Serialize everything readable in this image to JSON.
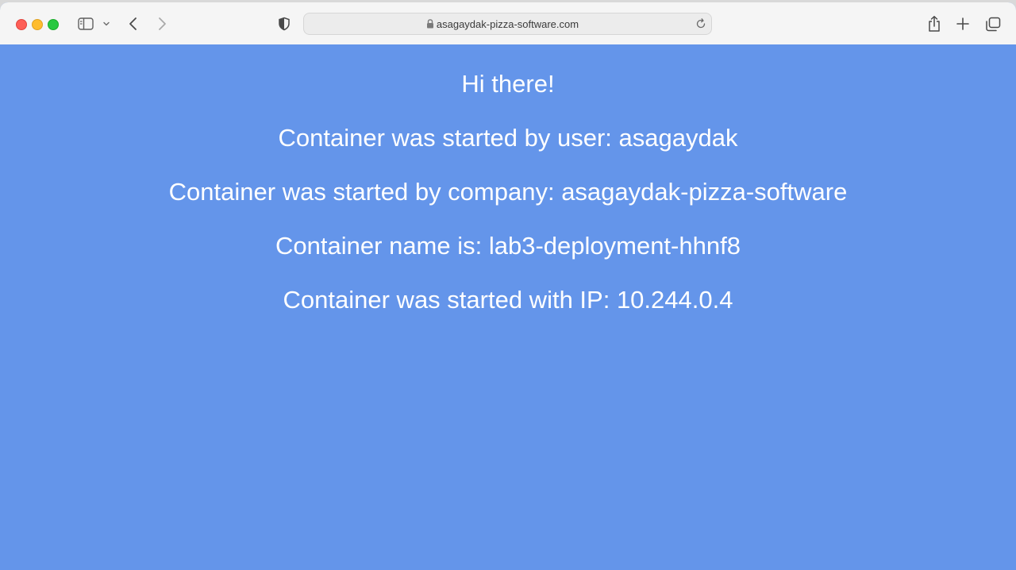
{
  "browser": {
    "url": "asagaydak-pizza-software.com",
    "icons": [
      "sidebar-icon",
      "chevron-down-icon",
      "back-icon",
      "forward-icon",
      "shield-icon",
      "lock-icon",
      "reload-icon",
      "share-icon",
      "plus-icon",
      "tabs-overview-icon"
    ]
  },
  "page": {
    "greeting": "Hi there!",
    "user_line": "Container was started by user: asagaydak",
    "company_line": "Container was started by company: asagaydak-pizza-software",
    "name_line": "Container name is: lab3-deployment-hhnf8",
    "ip_line": "Container was started with IP: 10.244.0.4"
  },
  "colors": {
    "page_background": "#6495ea",
    "text": "#ffffff",
    "toolbar": "#f5f5f5"
  }
}
